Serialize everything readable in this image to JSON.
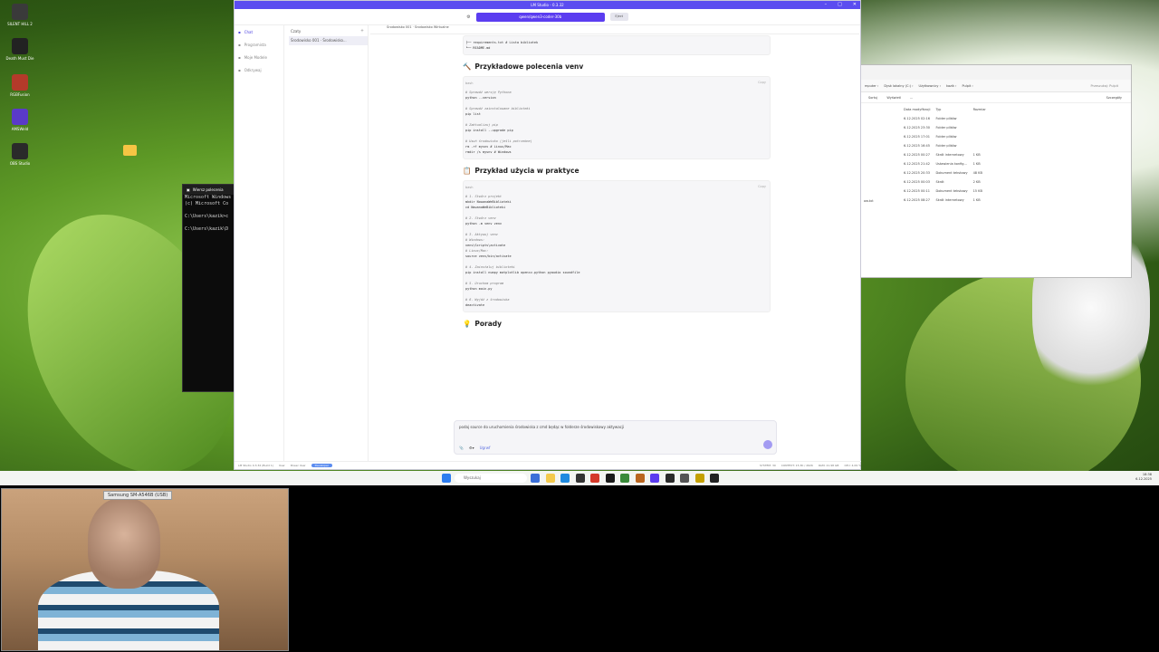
{
  "desktop": {
    "icons": [
      {
        "label": "SILENT HILL 2",
        "color": "#3a3a3a"
      },
      {
        "label": "Death Must Die",
        "color": "#222222"
      },
      {
        "label": "RGBFusion",
        "color": "#b43a2a"
      },
      {
        "label": "AMSWeld",
        "color": "#5a3ac8"
      },
      {
        "label": "OBS Studio",
        "color": "#2a2a2a"
      }
    ]
  },
  "cmd": {
    "title": "Wiersz polecenia",
    "lines": [
      "Microsoft Windows",
      "(c) Microsoft Co",
      "",
      "C:\\Users\\kazik>c",
      "",
      "C:\\Users\\kazik\\D"
    ]
  },
  "explorer": {
    "breadcrumb": [
      "mputer",
      "Dysk lokalny (C:)",
      "Użytkownicy",
      "kazik",
      "Pulpit"
    ],
    "search_placeholder": "Przeszukaj: Pulpit",
    "toolbar": [
      "Sortuj",
      "Wyświetl",
      "...",
      "Szczegóły"
    ],
    "columns": [
      "Data modyfikacji",
      "Typ",
      "Rozmiar"
    ],
    "rows": [
      [
        "6.12.2025 02:16",
        "Folder plików",
        ""
      ],
      [
        "6.12.2025 23:30",
        "Folder plików",
        ""
      ],
      [
        "6.12.2025 17:01",
        "Folder plików",
        ""
      ],
      [
        "6.12.2025 16:45",
        "Folder plików",
        ""
      ],
      [
        "6.12.2025 00:27",
        "Skrót internetowy",
        "1 KB"
      ],
      [
        "6.12.2025 21:42",
        "Ustawienia konfig...",
        "1 KB"
      ],
      [
        "6.12.2025 20:33",
        "Dokument tekstowy",
        "48 KB"
      ],
      [
        "6.12.2025 00:03",
        "Skrót",
        "2 KB"
      ],
      [
        "6.12.2025 00:11",
        "Dokument tekstowy",
        "15 KB"
      ],
      [
        "6.12.2025 08:27",
        "Skrót internetowy",
        "1 KB"
      ]
    ],
    "side_item": "ow.txt"
  },
  "lm": {
    "title": "LM Studio - 0.3.32",
    "model": "qwen/qwen3-coder-30b",
    "eject": "Eject",
    "sidebar": [
      "Chat",
      "Programista",
      "Moje Modele",
      "Odkrywaj"
    ],
    "chats_header": "Czaty",
    "chat_item": "Środowisko 001 · Środowisko...",
    "tab": "Środowisko 001 · Środowisko Wirtualne",
    "tree_lines": [
      "├── requirements.txt    # Lista bibliotek",
      "└── README.md"
    ],
    "sections": [
      {
        "heading": "Przykładowe polecenia venv",
        "icon": "🔨",
        "lang": "bash",
        "copy": "Copy",
        "lines": [
          {
            "t": "# Sprawdź wersję Pythona",
            "c": true
          },
          {
            "t": "python --version",
            "c": false
          },
          {
            "t": "",
            "c": false
          },
          {
            "t": "# Sprawdź zainstalowane biblioteki",
            "c": true
          },
          {
            "t": "pip list",
            "c": false
          },
          {
            "t": "",
            "c": false
          },
          {
            "t": "# Zaktualizuj pip",
            "c": true
          },
          {
            "t": "pip install --upgrade pip",
            "c": false
          },
          {
            "t": "",
            "c": false
          },
          {
            "t": "# Usuń środowisko (jeśli potrzebne)",
            "c": true
          },
          {
            "t": "rm -rf mysnv  # Linux/Mac",
            "c": false
          },
          {
            "t": "rmdir /s mysnv  # Windows",
            "c": false
          }
        ]
      },
      {
        "heading": "Przykład użycia w praktyce",
        "icon": "📋",
        "lang": "bash",
        "copy": "Copy",
        "lines": [
          {
            "t": "# 1. Stwórz projekt",
            "c": true
          },
          {
            "t": "mkdir NowanaWeBiblioteki",
            "c": false
          },
          {
            "t": "cd NowanaWeBiblioteki",
            "c": false
          },
          {
            "t": "",
            "c": false
          },
          {
            "t": "# 2. Stwórz venv",
            "c": true
          },
          {
            "t": "python -m venv venv",
            "c": false
          },
          {
            "t": "",
            "c": false
          },
          {
            "t": "# 3. Aktywuj venv",
            "c": true
          },
          {
            "t": "# Windows:",
            "c": true
          },
          {
            "t": "venv\\Scripts\\activate",
            "c": false
          },
          {
            "t": "# Linux/Mac:",
            "c": true
          },
          {
            "t": "source venv/bin/activate",
            "c": false
          },
          {
            "t": "",
            "c": false
          },
          {
            "t": "# 4. Zainstaluj biblioteki",
            "c": true
          },
          {
            "t": "pip install numpy matplotlib opencv-python pyaudio soundfile",
            "c": false
          },
          {
            "t": "",
            "c": false
          },
          {
            "t": "# 5. Uruchom program",
            "c": true
          },
          {
            "t": "python main.py",
            "c": false
          },
          {
            "t": "",
            "c": false
          },
          {
            "t": "# 6. Wyjdź z środowiska",
            "c": true
          },
          {
            "t": "deactivate",
            "c": false
          }
        ]
      }
    ],
    "tips_heading": "Porady",
    "tips_icon": "💡",
    "input_text": "podaj source do uruchomienia środowiska z cmd będąc w folderze środowiskowy aktywacji",
    "input_chip": "Ugrwf",
    "status": [
      "LM Studio 0.3.32 (Build 1)",
      "User",
      "Power User",
      "Developer",
      "SYSTEM: 30",
      "CONTEXT: 15.3K / 262K",
      "RAM: 21.98 GB",
      "CPU: 4.09 %"
    ]
  },
  "taskbar": {
    "search_placeholder": "Wyszukaj",
    "time": "18:38",
    "date": "6.12.2025",
    "icons": [
      "#3b6fd8",
      "#f3c94c",
      "#1f8ae0",
      "#333",
      "#d43a2a",
      "#1a1a1a",
      "#3a8a3a",
      "#b9651f",
      "#5b3df0",
      "#2a2a2a",
      "#555",
      "#c4a000",
      "#222"
    ]
  },
  "webcam": {
    "label": "Samsung SM-A546B (USB)"
  }
}
